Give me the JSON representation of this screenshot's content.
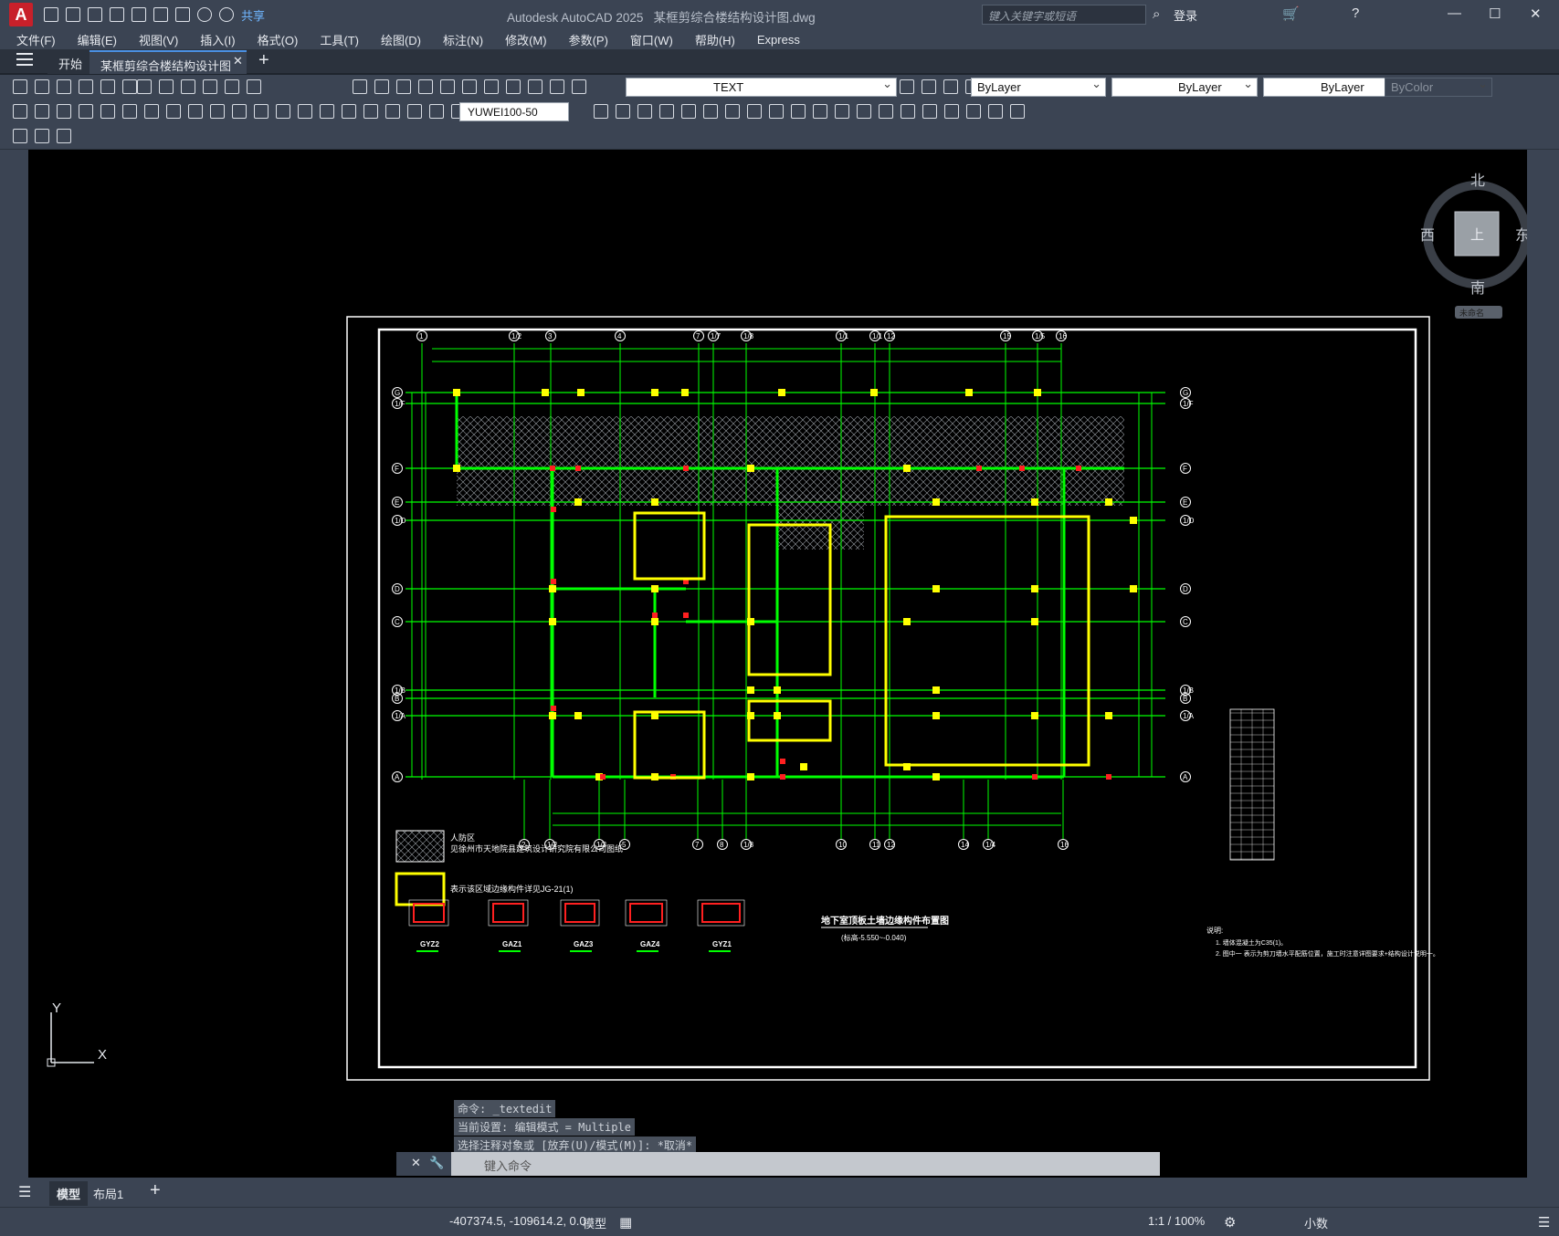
{
  "app": {
    "title": "Autodesk AutoCAD 2025",
    "document": "某框剪综合楼结构设计图.dwg",
    "share": "共享",
    "search_placeholder": "键入关键字或短语",
    "login": "登录"
  },
  "menu": [
    "文件(F)",
    "编辑(E)",
    "视图(V)",
    "插入(I)",
    "格式(O)",
    "工具(T)",
    "绘图(D)",
    "标注(N)",
    "修改(M)",
    "参数(P)",
    "窗口(W)",
    "帮助(H)",
    "Express"
  ],
  "tabs": {
    "start": "开始",
    "doc": "某框剪综合楼结构设计图*"
  },
  "toolbar": {
    "layer": "TEXT",
    "color": "ByLayer",
    "linetype": "ByLayer",
    "lineweight": "ByLayer",
    "plotstyle": "ByColor",
    "dimstyle": "YUWEI100-50"
  },
  "viewcube": {
    "north": "北",
    "south": "南",
    "east": "东",
    "west": "西",
    "top": "上",
    "wcs": "未命名"
  },
  "command": {
    "history": [
      "命令: _textedit",
      "当前设置: 编辑模式 = Multiple",
      "选择注释对象或 [放弃(U)/模式(M)]: *取消*"
    ],
    "placeholder": "键入命令"
  },
  "layout_tabs": [
    "模型",
    "布局1"
  ],
  "status": {
    "coords": "-407374.5, -109614.2, 0.0",
    "model": "模型",
    "scale": "1:1 / 100%",
    "units": "小数"
  },
  "drawing": {
    "title": "地下室顶板土墙边缘构件布置图",
    "subtitle": "(标高-5.550~-0.040)",
    "legend1a": "人防区",
    "legend1b": "见徐州市天地院县建筑设计研究院有限公司图纸",
    "legend2": "表示该区域边缘构件详见JG-21(1)",
    "notes_title": "说明:",
    "note1": "1. 墙体混凝土为C35(1)。",
    "note2": "2. 图中一 表示为剪刀墙水平配筋位置，施工时注意详图要求+结构设计说明一。",
    "details": [
      "GYZ2",
      "GAZ1",
      "GAZ3",
      "GAZ4",
      "GYZ1"
    ],
    "col_labels_top": [
      "1",
      "1/2",
      "3",
      "4",
      "7",
      "1/7",
      "1/8",
      "1/1",
      "1/1",
      "12",
      "15",
      "1/5",
      "16"
    ],
    "col_labels_bottom": [
      "2",
      "1/2",
      "1/3",
      "5",
      "7",
      "8",
      "1/8",
      "10",
      "11",
      "12",
      "14",
      "1/4",
      "16"
    ],
    "row_labels": [
      "G",
      "1/F",
      "F",
      "E",
      "1/D",
      "D",
      "C",
      "1/B",
      "B",
      "1/A",
      "A"
    ]
  }
}
